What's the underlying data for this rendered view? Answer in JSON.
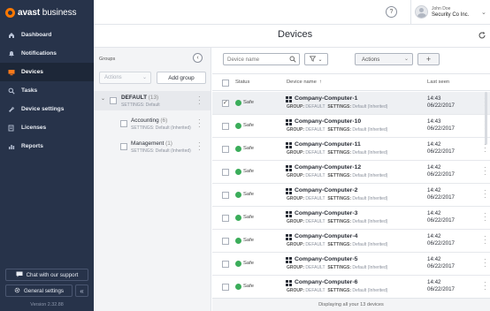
{
  "brand": {
    "name_bold": "avast",
    "name_light": " business",
    "accent": "#ff7800"
  },
  "sidebar": {
    "items": [
      {
        "label": "Dashboard",
        "icon": "home-icon",
        "active": false
      },
      {
        "label": "Notifications",
        "icon": "bell-icon",
        "active": false
      },
      {
        "label": "Devices",
        "icon": "monitor-icon",
        "active": true
      },
      {
        "label": "Tasks",
        "icon": "search-icon",
        "active": false
      },
      {
        "label": "Device settings",
        "icon": "wrench-icon",
        "active": false
      },
      {
        "label": "Licenses",
        "icon": "license-icon",
        "active": false
      },
      {
        "label": "Reports",
        "icon": "chart-icon",
        "active": false
      }
    ],
    "support_label": "Chat with our support",
    "settings_label": "General settings",
    "version": "Version 2.32.88"
  },
  "header": {
    "help": "?",
    "user_name": "John Doe",
    "company": "Security Co Inc.",
    "page_title": "Devices"
  },
  "groups": {
    "label": "Groups",
    "actions_label": "Actions",
    "add_label": "Add group",
    "root": {
      "name": "DEFAULT",
      "count": "(13)",
      "settings": "SETTINGS: Default"
    },
    "children": [
      {
        "name": "Accounting",
        "count": "(6)",
        "settings": "SETTINGS: Default (Inherited)"
      },
      {
        "name": "Management",
        "count": "(1)",
        "settings": "SETTINGS: Default (Inherited)"
      }
    ]
  },
  "devices": {
    "search_placeholder": "Device name",
    "actions_label": "Actions",
    "add_label": "+",
    "columns": {
      "status": "Status",
      "name": "Device name",
      "last_seen": "Last seen"
    },
    "group_key": "GROUP:",
    "settings_key": "SETTINGS:",
    "rows": [
      {
        "name": "Company-Computer-1",
        "status": "Safe",
        "group": "DEFAULT",
        "settings": "Default (Inherited)",
        "time": "14:43",
        "date": "06/22/2017",
        "selected": true
      },
      {
        "name": "Company-Computer-10",
        "status": "Safe",
        "group": "DEFAULT",
        "settings": "Default (Inherited)",
        "time": "14:43",
        "date": "06/22/2017",
        "selected": false
      },
      {
        "name": "Company-Computer-11",
        "status": "Safe",
        "group": "DEFAULT",
        "settings": "Default (Inherited)",
        "time": "14:42",
        "date": "06/22/2017",
        "selected": false
      },
      {
        "name": "Company-Computer-12",
        "status": "Safe",
        "group": "DEFAULT",
        "settings": "Default (Inherited)",
        "time": "14:42",
        "date": "06/22/2017",
        "selected": false
      },
      {
        "name": "Company-Computer-2",
        "status": "Safe",
        "group": "DEFAULT",
        "settings": "Default (Inherited)",
        "time": "14:42",
        "date": "06/22/2017",
        "selected": false
      },
      {
        "name": "Company-Computer-3",
        "status": "Safe",
        "group": "DEFAULT",
        "settings": "Default (Inherited)",
        "time": "14:42",
        "date": "06/22/2017",
        "selected": false
      },
      {
        "name": "Company-Computer-4",
        "status": "Safe",
        "group": "DEFAULT",
        "settings": "Default (Inherited)",
        "time": "14:42",
        "date": "06/22/2017",
        "selected": false
      },
      {
        "name": "Company-Computer-5",
        "status": "Safe",
        "group": "DEFAULT",
        "settings": "Default (Inherited)",
        "time": "14:42",
        "date": "06/22/2017",
        "selected": false
      },
      {
        "name": "Company-Computer-6",
        "status": "Safe",
        "group": "DEFAULT",
        "settings": "Default (Inherited)",
        "time": "14:42",
        "date": "06/22/2017",
        "selected": false
      }
    ],
    "footer": "Displaying all your 13 devices",
    "status_color": "#3bad5a"
  }
}
